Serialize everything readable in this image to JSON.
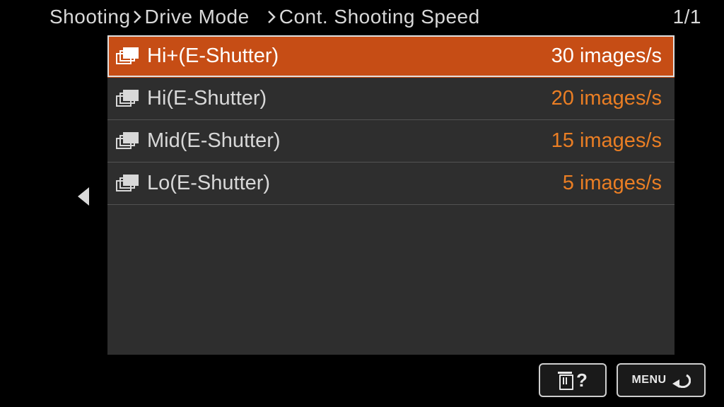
{
  "breadcrumb": {
    "items": [
      "Shooting",
      "Drive Mode",
      "Cont. Shooting Speed"
    ],
    "page": "1/1"
  },
  "menu": {
    "items": [
      {
        "label": "Hi+(E-Shutter)",
        "value": "30 images/s",
        "selected": true
      },
      {
        "label": "Hi(E-Shutter)",
        "value": "20 images/s",
        "selected": false
      },
      {
        "label": "Mid(E-Shutter)",
        "value": "15 images/s",
        "selected": false
      },
      {
        "label": "Lo(E-Shutter)",
        "value": "5 images/s",
        "selected": false
      }
    ]
  },
  "bottombar": {
    "help_label": "?",
    "menu_label": "MENU"
  }
}
